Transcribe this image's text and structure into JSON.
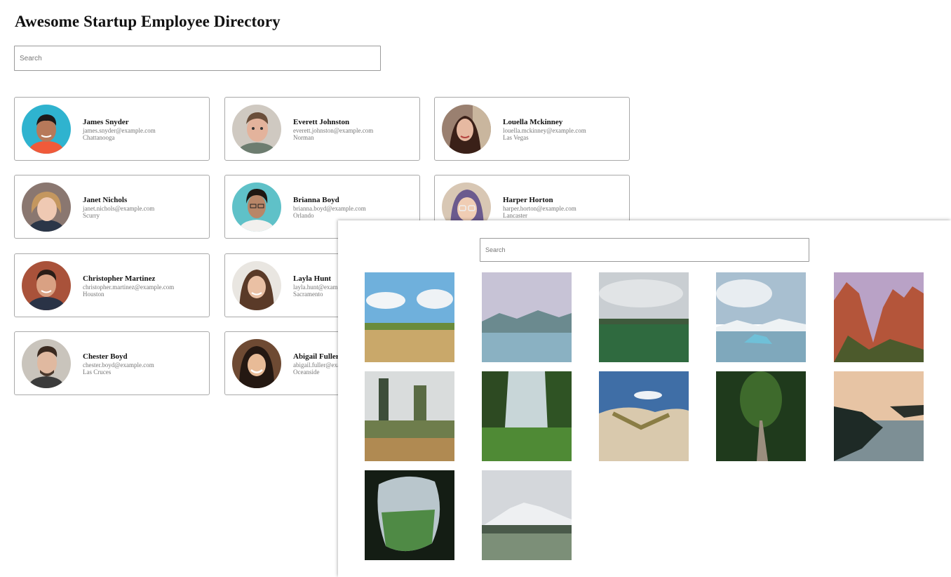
{
  "directory": {
    "title": "Awesome Startup Employee Directory",
    "search_placeholder": "Search",
    "employees": [
      {
        "name": "James Snyder",
        "email": "james.snyder@example.com",
        "city": "Chattanooga"
      },
      {
        "name": "Everett Johnston",
        "email": "everett.johnston@example.com",
        "city": "Norman"
      },
      {
        "name": "Louella Mckinney",
        "email": "louella.mckinney@example.com",
        "city": "Las Vegas"
      },
      {
        "name": "Janet Nichols",
        "email": "janet.nichols@example.com",
        "city": "Scurry"
      },
      {
        "name": "Brianna Boyd",
        "email": "brianna.boyd@example.com",
        "city": "Orlando"
      },
      {
        "name": "Harper Horton",
        "email": "harper.horton@example.com",
        "city": "Lancaster"
      },
      {
        "name": "Christopher Martinez",
        "email": "christopher.martinez@example.com",
        "city": "Houston"
      },
      {
        "name": "Layla Hunt",
        "email": "layla.hunt@example.com",
        "city": "Sacramento"
      },
      {
        "name": "Chester Boyd",
        "email": "chester.boyd@example.com",
        "city": "Las Cruces"
      },
      {
        "name": "Abigail Fuller",
        "email": "abigail.fuller@example.com",
        "city": "Oceanside"
      }
    ]
  },
  "gallery": {
    "search_placeholder": "Search",
    "photos": [
      {
        "icon": "wheat-field-photo-icon"
      },
      {
        "icon": "mountain-lake-photo-icon"
      },
      {
        "icon": "green-meadow-photo-icon"
      },
      {
        "icon": "iceberg-lagoon-photo-icon"
      },
      {
        "icon": "red-rock-canyon-photo-icon"
      },
      {
        "icon": "garden-trees-photo-icon"
      },
      {
        "icon": "forest-valley-photo-icon"
      },
      {
        "icon": "sand-dunes-photo-icon"
      },
      {
        "icon": "forest-path-photo-icon"
      },
      {
        "icon": "sunset-coast-photo-icon"
      },
      {
        "icon": "cave-opening-photo-icon"
      },
      {
        "icon": "snowy-mountain-field-photo-icon"
      }
    ]
  }
}
